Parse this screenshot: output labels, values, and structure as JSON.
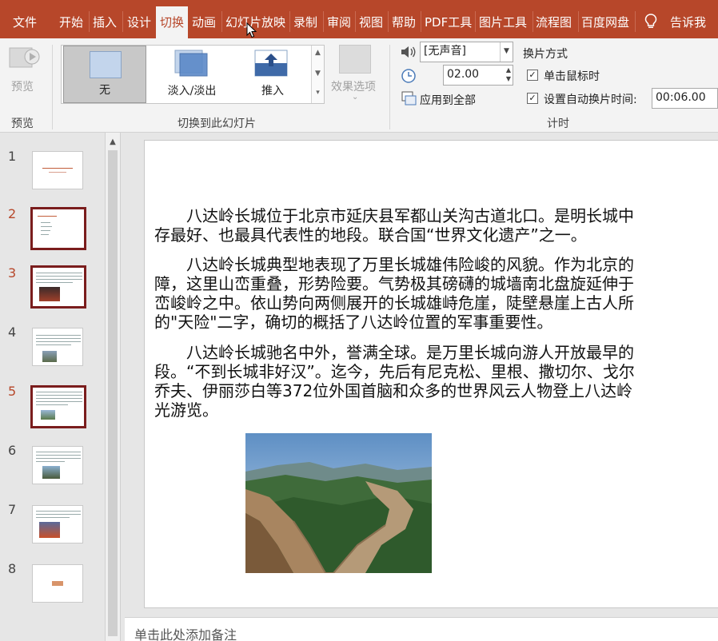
{
  "tabs": [
    "文件",
    "开始",
    "插入",
    "设计",
    "切换",
    "动画",
    "幻灯片放映",
    "录制",
    "审阅",
    "视图",
    "帮助",
    "PDF工具",
    "图片工具",
    "流程图",
    "百度网盘",
    "告诉我"
  ],
  "active_tab": "切换",
  "ribbon": {
    "preview_label": "预览",
    "preview_group": "预览",
    "gallery_items": [
      "无",
      "淡入/淡出",
      "推入"
    ],
    "effect_options": "效果选项",
    "transition_group": "切换到此幻灯片",
    "sound_value": "[无声音]",
    "duration_value": "02.00",
    "apply_all": "应用到全部",
    "advance_title": "换片方式",
    "on_click": "单击鼠标时",
    "auto_after": "设置自动换片时间:",
    "auto_time": "00:06.00",
    "timing_group": "计时",
    "on_click_checked": true,
    "auto_checked": true
  },
  "slides": [
    {
      "num": "1",
      "selected": false
    },
    {
      "num": "2",
      "selected": true
    },
    {
      "num": "3",
      "selected": true
    },
    {
      "num": "4",
      "selected": false
    },
    {
      "num": "5",
      "selected": true
    },
    {
      "num": "6",
      "selected": false
    },
    {
      "num": "7",
      "selected": false
    },
    {
      "num": "8",
      "selected": false
    }
  ],
  "content": {
    "paragraphs": [
      [
        "　　八达岭长城位于北京市延庆县军都山关沟古道北口。是明长城中",
        "存最好、也最具代表性的地段。联合国“世界文化遗产”之一。"
      ],
      [
        "　　八达岭长城典型地表现了万里长城雄伟险峻的风貌。作为北京的",
        "障，这里山峦重叠，形势险要。气势极其磅礴的城墙南北盘旋延伸于",
        "峦峻岭之中。依山势向两侧展开的长城雄峙危崖，陡壁悬崖上古人所",
        "的\"天险\"二字，确切的概括了八达岭位置的军事重要性。"
      ],
      [
        "　　八达岭长城驰名中外，誉满全球。是万里长城向游人开放最早的",
        "段。“不到长城非好汉”。迄今，先后有尼克松、里根、撒切尔、戈尔",
        "乔夫、伊丽莎白等372位外国首脑和众多的世界风云人物登上八达岭",
        "光游览。"
      ]
    ]
  },
  "notes_placeholder": "单击此处添加备注",
  "colors": {
    "accent": "#b7472a",
    "selection": "#7a1d1d"
  }
}
